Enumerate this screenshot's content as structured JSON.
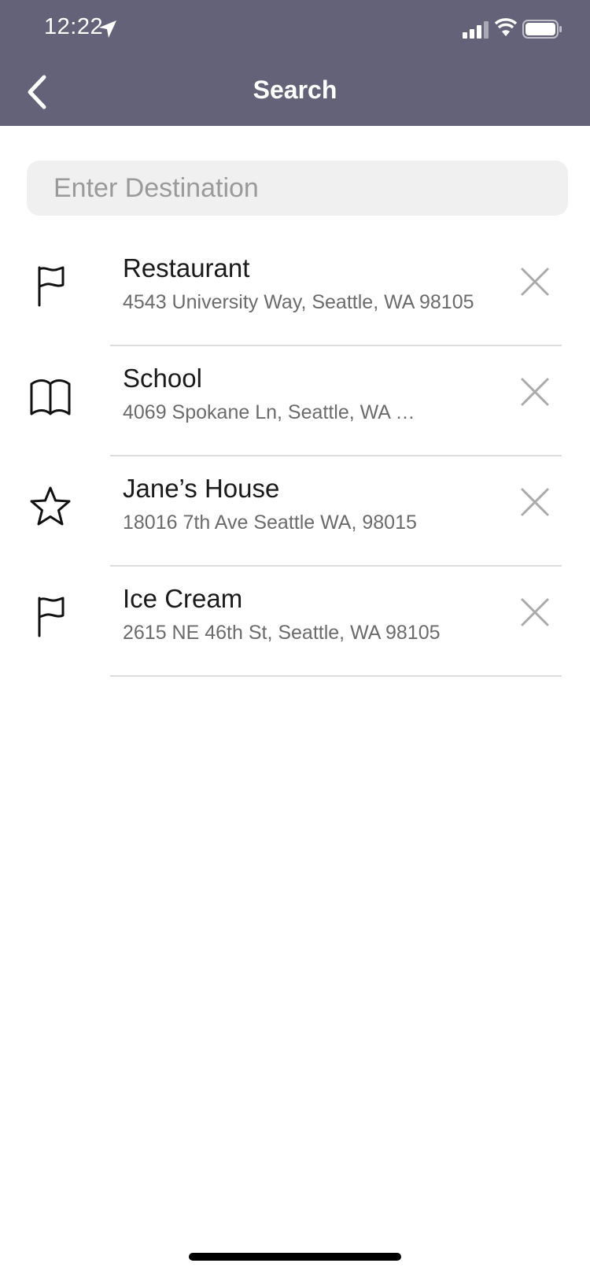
{
  "status_bar": {
    "time": "12:22",
    "location_icon": "location-arrow-icon",
    "signal_icon": "cellular-signal-icon",
    "wifi_icon": "wifi-icon",
    "battery_icon": "battery-icon"
  },
  "header": {
    "title": "Search",
    "back_icon": "chevron-left-icon",
    "background_color": "#636278"
  },
  "search": {
    "placeholder": "Enter Destination",
    "value": ""
  },
  "places": [
    {
      "icon": "flag-icon",
      "name": "Restaurant",
      "address": "4543 University Way, Seattle, WA 98105"
    },
    {
      "icon": "book-icon",
      "name": "School",
      "address": "4069 Spokane Ln, Seattle, WA 98..."
    },
    {
      "icon": "star-icon",
      "name": "Jane’s House",
      "address": "18016 7th Ave Seattle WA, 98015"
    },
    {
      "icon": "flag-icon",
      "name": "Ice Cream",
      "address": "2615 NE 46th St, Seattle, WA 98105"
    }
  ],
  "remove_icon": "close-icon"
}
